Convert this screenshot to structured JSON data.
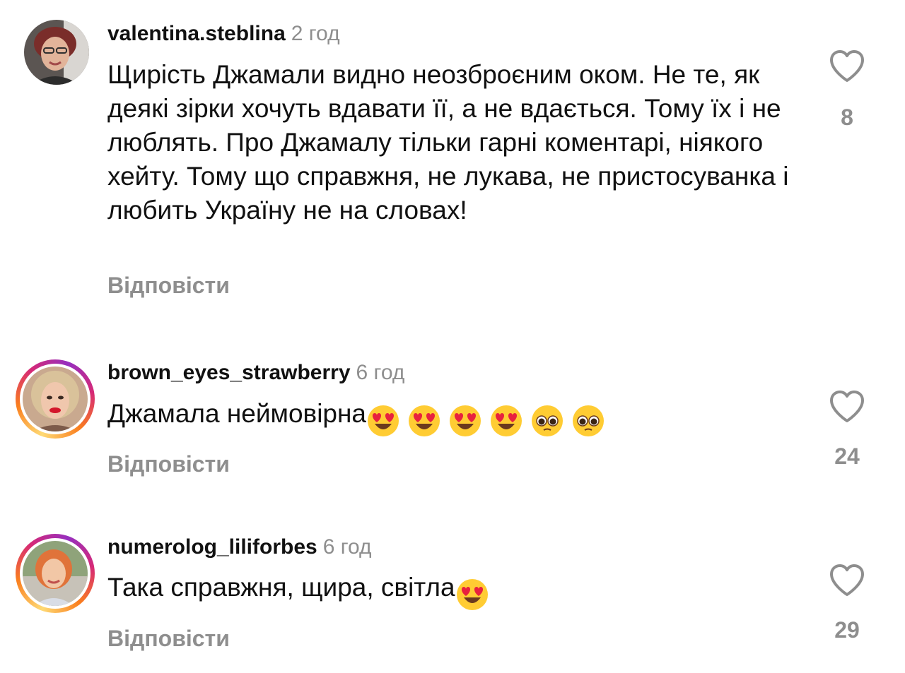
{
  "comments": [
    {
      "username": "valentina.steblina",
      "time": "2 год",
      "text": "Щирість Джамали видно неозброєним оком. Не те, як деякі зірки хочуть вдавати її, а не вдається. Тому їх і не люблять. Про Джамалу тільки гарні коментарі, ніякого хейту. Тому що справжня, не лукава, не пристосуванка і любить Україну не на словах!",
      "reply_label": "Відповісти",
      "likes": "8",
      "has_story_ring": false,
      "emojis": []
    },
    {
      "username": "brown_eyes_strawberry",
      "time": "6 год",
      "text": "Джамала неймовірна",
      "reply_label": "Відповісти",
      "likes": "24",
      "has_story_ring": true,
      "emojis": [
        "heart-eyes-emoji",
        "heart-eyes-emoji",
        "heart-eyes-emoji",
        "heart-eyes-emoji",
        "pleading-face-emoji",
        "pleading-face-emoji"
      ]
    },
    {
      "username": "numerolog_liliforbes",
      "time": "6 год",
      "text": "Така справжня, щира, світла",
      "reply_label": "Відповісти",
      "likes": "29",
      "has_story_ring": true,
      "emojis": [
        "heart-eyes-emoji"
      ]
    }
  ],
  "colors": {
    "secondary_text": "#8e8e8e",
    "primary_text": "#111111",
    "emoji_face": "#ffcc33"
  },
  "icons": {
    "like": "heart-outline-icon"
  }
}
